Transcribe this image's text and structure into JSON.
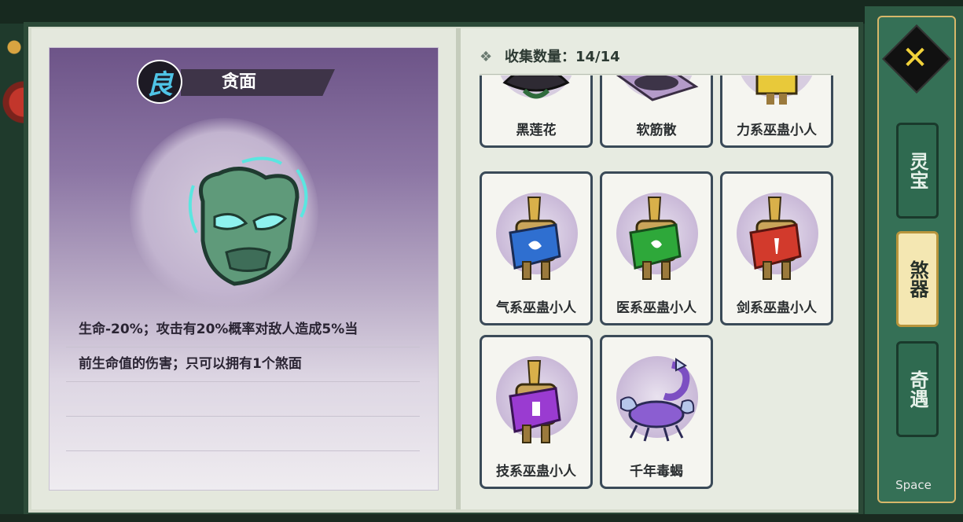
{
  "detail": {
    "grade_glyph": "良",
    "name": "贪面",
    "description_lines": [
      "生命-20%；攻击有20%概率对敌人造成5%当",
      "前生命值的伤害；只可以拥有1个煞面"
    ]
  },
  "collection": {
    "count_label": "收集数量：14/14",
    "items": [
      {
        "label": "黑莲花"
      },
      {
        "label": "软筋散"
      },
      {
        "label": "力系巫蛊小人"
      },
      {
        "label": "气系巫蛊小人"
      },
      {
        "label": "医系巫蛊小人"
      },
      {
        "label": "剑系巫蛊小人"
      },
      {
        "label": "技系巫蛊小人"
      },
      {
        "label": "千年毒蝎"
      }
    ]
  },
  "tabs": [
    {
      "label": "灵宝",
      "active": false
    },
    {
      "label": "煞器",
      "active": true
    },
    {
      "label": "奇遇",
      "active": false
    }
  ],
  "close_icon": "✕",
  "hint": {
    "key": "Space"
  },
  "colors": {
    "card_purple": "#6d5488",
    "mask_green": "#5f9a7a",
    "tab_active": "#f4e7b2",
    "panel_green": "#2d5a44"
  }
}
